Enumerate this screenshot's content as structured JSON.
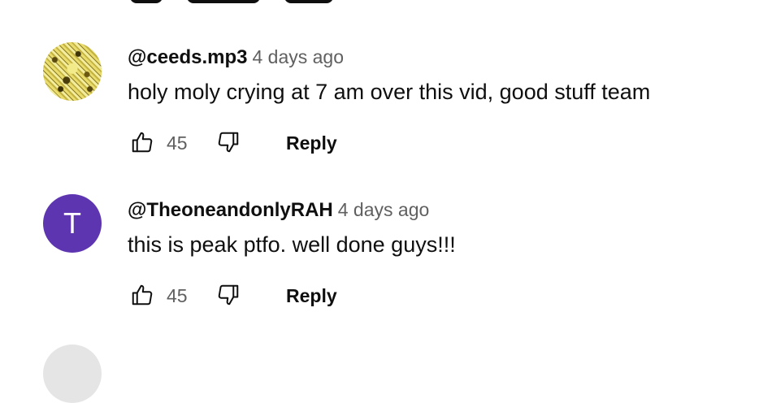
{
  "comments": [
    {
      "author": "@ceeds.mp3",
      "time": "4 days ago",
      "text": "holy moly crying at 7 am over this vid, good stuff team",
      "likes": "45",
      "reply_label": "Reply",
      "avatar": {
        "type": "image",
        "color": "#d9cc5a"
      }
    },
    {
      "author": "@TheoneandonlyRAH",
      "time": "4 days ago",
      "text": "this is peak ptfo. well done guys!!!",
      "likes": "45",
      "reply_label": "Reply",
      "avatar": {
        "type": "letter",
        "letter": "T",
        "color": "#5e35b1"
      }
    }
  ],
  "colors": {
    "text": "#0f0f0f",
    "secondary_text": "#606060",
    "background": "#ffffff"
  },
  "icons": {
    "like": "thumbs-up-icon",
    "dislike": "thumbs-down-icon"
  }
}
